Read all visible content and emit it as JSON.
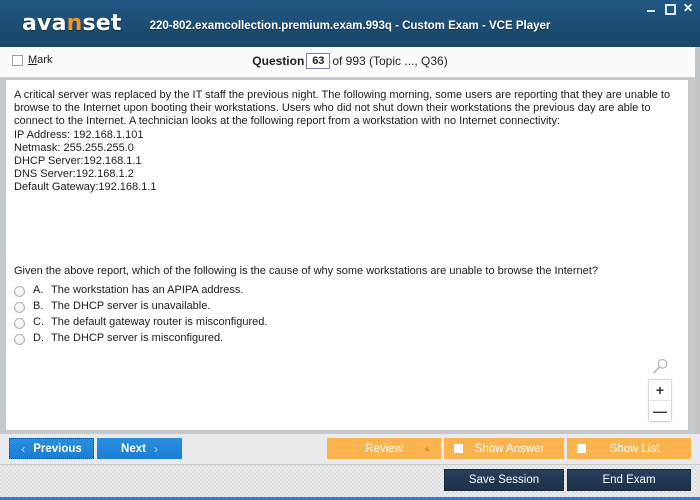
{
  "window": {
    "title": "220-802.examcollection.premium.exam.993q - Custom Exam - VCE Player",
    "logo_text_1": "ava",
    "logo_accent": "n",
    "logo_text_2": "set",
    "minimize_label": "Minimize",
    "maximize_label": "Maximize",
    "close_label": "✕"
  },
  "header": {
    "mark_label": "Mark",
    "question_word": "Question",
    "question_number": "63",
    "of_text": "of 993 (Topic ..., Q36)"
  },
  "question": {
    "body_paragraph": "A critical server was replaced by the IT staff the previous night. The following morning, some users are reporting that they are unable to browse to the Internet upon booting their workstations. Users who did not shut down their workstations the previous day are able to connect to the Internet. A technician looks at the following report from a workstation with no Internet connectivity:",
    "report": [
      "IP Address: 192.168.1.101",
      "Netmask: 255.255.255.0",
      "DHCP Server:192.168.1.1",
      "DNS Server:192.168.1.2",
      "Default Gateway:192.168.1.1"
    ],
    "prompt": "Given the above report, which of the following is the cause of why some workstations are unable to browse the Internet?",
    "options": [
      {
        "letter": "A.",
        "text": "The workstation has an APIPA address."
      },
      {
        "letter": "B.",
        "text": "The DHCP server is unavailable."
      },
      {
        "letter": "C.",
        "text": "The default gateway router is misconfigured."
      },
      {
        "letter": "D.",
        "text": "The DHCP server is misconfigured."
      }
    ]
  },
  "zoom_control": {
    "magnifier_icon": "magnifier-icon",
    "zoom_in_label": "+",
    "zoom_out_label": "—"
  },
  "navbar": {
    "previous_label": "Previous",
    "previous_chevron": "‹",
    "next_label": "Next",
    "next_chevron": "›",
    "review_label": "Review",
    "review_caret": "▲",
    "show_answer_label": "Show Answer",
    "show_list_label": "Show List"
  },
  "statusbar": {
    "save_session_label": "Save Session",
    "end_exam_label": "End Exam"
  },
  "colors": {
    "titlebar": "#1d4f77",
    "accent_orange": "#f0962a",
    "button_blue": "#1a7fd4",
    "button_orange": "#fbb34d",
    "button_dark": "#27405c",
    "bottom_strip": "#2a7fd0"
  }
}
